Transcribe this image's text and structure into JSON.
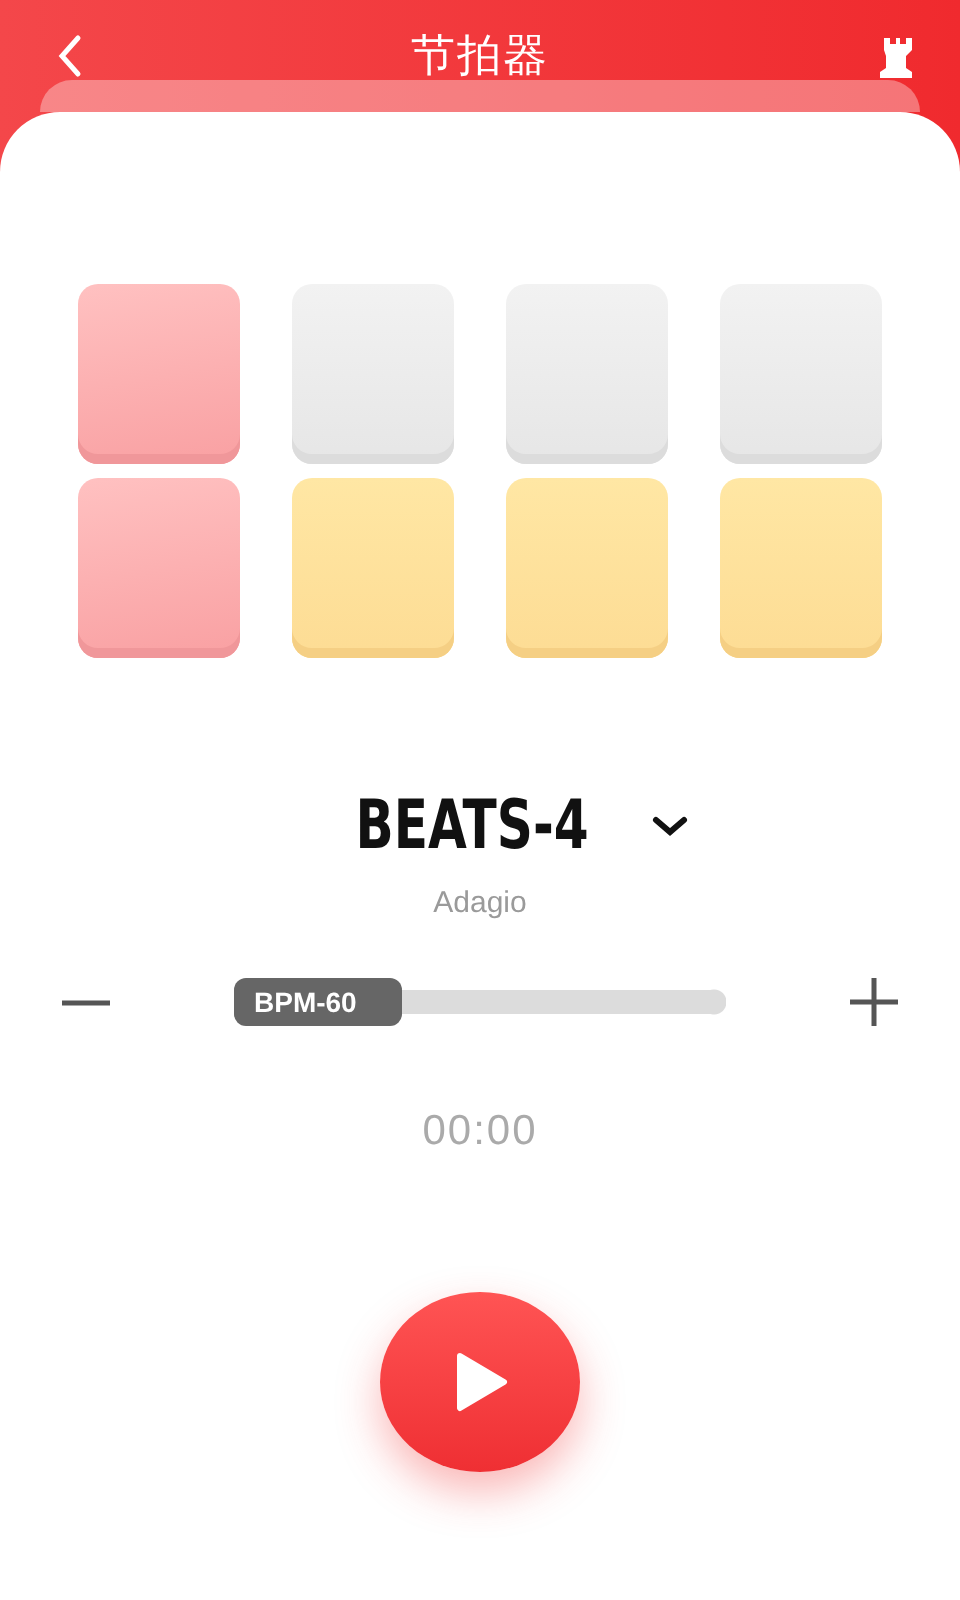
{
  "header": {
    "title": "节拍器"
  },
  "beats": [
    {
      "pads": [
        {
          "kind": "accent"
        },
        {
          "kind": "accent"
        }
      ]
    },
    {
      "pads": [
        {
          "kind": "off"
        },
        {
          "kind": "normal"
        }
      ]
    },
    {
      "pads": [
        {
          "kind": "off"
        },
        {
          "kind": "normal"
        }
      ]
    },
    {
      "pads": [
        {
          "kind": "off"
        },
        {
          "kind": "normal"
        }
      ]
    }
  ],
  "meter": {
    "label": "BEATS-4",
    "tempo_name": "Adagio"
  },
  "tempo_slider": {
    "label": "BPM-60",
    "level": 0
  },
  "timer": "00:00"
}
